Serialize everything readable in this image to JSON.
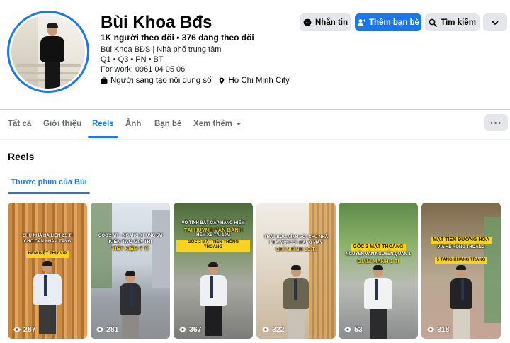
{
  "profile": {
    "name": "Bùi Khoa Bđs",
    "follow_line": "1K người theo dõi • 376 đang theo dõi",
    "bio_line1": "Bùi Khoa BĐS | Nhà phố trung tâm",
    "bio_line2": "Q1 • Q3 • PN • BT",
    "bio_line3": "For work: 0961 04 05 06",
    "category": "Người sáng tạo nội dung số",
    "location": "Ho Chi Minh City"
  },
  "actions": {
    "message": "Nhắn tin",
    "add_friend": "Thêm bạn bè",
    "search": "Tìm kiếm"
  },
  "tabs": [
    {
      "label": "Tất cả"
    },
    {
      "label": "Giới thiệu"
    },
    {
      "label": "Reels"
    },
    {
      "label": "Ảnh"
    },
    {
      "label": "Bạn bè"
    },
    {
      "label": "Xem thêm"
    }
  ],
  "reels": {
    "title": "Reels",
    "subtab": "Thước phim của Bùi",
    "items": [
      {
        "cap1": "CHU NHÀ HẠ LIỀN 2,5 TỈ",
        "cap2": "CHO CĂN NHÀ 4 TẦNG",
        "cap3": "HẺM BIỆT THỰ VIP",
        "views": "287"
      },
      {
        "cap1": "GÓC 2 MT - NGANG KHỦNG 5M",
        "cap2": "KIẾN TẠO GIÁ TRỊ",
        "cap3": "TIẾT KIỆM 7 TỈ",
        "views": "281"
      },
      {
        "cap1": "VÔ TÌNH BẮT GẶP HÀNG HIẾM",
        "cap2": "TẠI HUỲNH VĂN BÁNH",
        "cap3": "HẺM XE TẢI 10M",
        "cap4": "GÓC 2 MẶT TIỀN THÔNG THOÁNG",
        "views": "367"
      },
      {
        "cap1": "THẬT BỨC MÌNH VỚI CHỦ NHÀ",
        "cap2": "NHÀ MỚI CÓ THANG MÁY",
        "cap3": "CHỈ NHỈNH 10 TỈ",
        "views": "322"
      },
      {
        "cap1": "GÓC 3 MẶT THOÁNG",
        "cap2": "NGUYỄN VĂN NGUYỄN QUẬN 1",
        "cap3": "GIẢM MẠNH 1 TỈ",
        "views": "53"
      },
      {
        "cap1": "MẶT TIỀN ĐƯỜNG HOA",
        "cap2": "VỈA HÈ RỘNG THOÁNG",
        "cap3": "5 TẦNG KHANG TRANG",
        "views": "318"
      }
    ]
  },
  "colors": {
    "accent": "#1877f2",
    "caption_yellow": "#f7d21e"
  }
}
